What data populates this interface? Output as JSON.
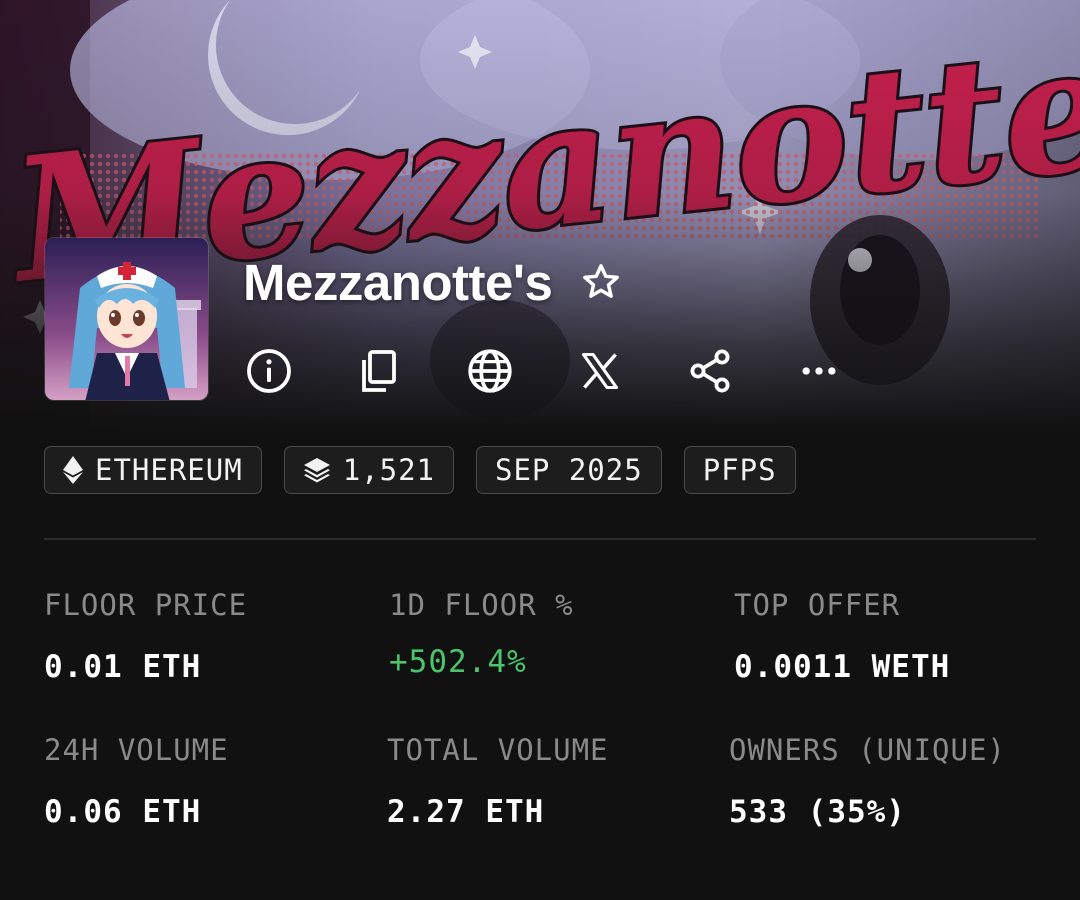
{
  "collection": {
    "name": "Mezzanotte's",
    "banner_text": "Mezzanotte",
    "avatar_icon": "nurse-anime-avatar"
  },
  "actions": [
    {
      "name": "info",
      "icon": "info-icon"
    },
    {
      "name": "copy",
      "icon": "copy-icon"
    },
    {
      "name": "website",
      "icon": "globe-icon"
    },
    {
      "name": "x",
      "icon": "x-logo-icon"
    },
    {
      "name": "share",
      "icon": "share-icon"
    },
    {
      "name": "more",
      "icon": "more-icon"
    }
  ],
  "chips": {
    "chain": "ETHEREUM",
    "items": "1,521",
    "date": "SEP 2025",
    "category": "PFPS"
  },
  "stats": {
    "floor_price": {
      "label": "FLOOR PRICE",
      "value": "0.01 ETH"
    },
    "floor_change": {
      "label": "1D FLOOR %",
      "value": "+502.4%"
    },
    "top_offer": {
      "label": "TOP OFFER",
      "value": "0.0011 WETH"
    },
    "volume_24h": {
      "label": "24H VOLUME",
      "value": "0.06 ETH"
    },
    "total_volume": {
      "label": "TOTAL VOLUME",
      "value": "2.27 ETH"
    },
    "owners": {
      "label": "OWNERS (UNIQUE)",
      "value": "533 (35%)"
    }
  },
  "colors": {
    "background": "#111111",
    "positive": "#4cc46a",
    "banner_pink": "#c8204e",
    "banner_lavender": "#9c9ccc"
  }
}
